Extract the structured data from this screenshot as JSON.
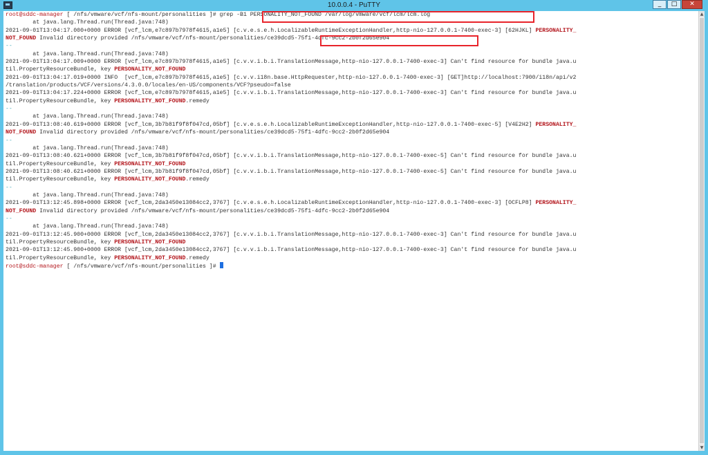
{
  "window": {
    "title": "10.0.0.4 - PuTTY",
    "controls": {
      "minimize": "_",
      "maximize": "□",
      "close": "✕"
    },
    "colors": {
      "titlebar": "#5fc4e8",
      "accent_red": "#b3161c",
      "highlight_box": "#e8232a",
      "cursor": "#1e6fe0"
    }
  },
  "terminal": {
    "lines": [
      [
        {
          "t": "root@sddc-manager",
          "c": "prompt"
        },
        {
          "t": " [ /nfs/vmware/vcf/nfs-mount/personalities ]# ",
          "c": "path"
        },
        {
          "t": "grep -B1 PERSONALITY_NOT_FOUND /var/log/vmware/vcf/lcm/lcm.log",
          "c": "path"
        }
      ],
      [
        {
          "t": "        at java.lang.Thread.run(Thread.java:748)",
          "c": "path"
        }
      ],
      [
        {
          "t": "2021-09-01T13:04:17.000+0000 ERROR [vcf_lcm,e7c897b7978f4615,a1e5] [c.v.e.s.e.h.LocalizableRuntimeExceptionHandler,http-nio-127.0.0.1-7400-exec-3] [62HJKL] ",
          "c": "path"
        },
        {
          "t": "PERSONALITY_",
          "c": "red"
        }
      ],
      [
        {
          "t": "NOT_FOUND",
          "c": "red"
        },
        {
          "t": " Invalid directory provided /nfs/vmware/vcf/nfs-mount/personalities/",
          "c": "path"
        },
        {
          "t": "ce39dcd5-75f1-4dfc-9cc2-2b0f2d65e904",
          "c": "path"
        }
      ],
      [
        {
          "t": "--",
          "c": "cyan"
        }
      ],
      [
        {
          "t": "        at java.lang.Thread.run(Thread.java:748)",
          "c": "path"
        }
      ],
      [
        {
          "t": "2021-09-01T13:04:17.009+0000 ERROR [vcf_lcm,e7c897b7978f4615,a1e5] [c.v.v.i.b.i.TranslationMessage,http-nio-127.0.0.1-7400-exec-3] Can't find resource for bundle java.u",
          "c": "path"
        }
      ],
      [
        {
          "t": "til.PropertyResourceBundle, key ",
          "c": "path"
        },
        {
          "t": "PERSONALITY_NOT_FOUND",
          "c": "red"
        }
      ],
      [
        {
          "t": "2021-09-01T13:04:17.019+0000 INFO  [vcf_lcm,e7c897b7978f4615,a1e5] [c.v.v.i18n.base.HttpRequester,http-nio-127.0.0.1-7400-exec-3] [GET]http://localhost:7900/i18n/api/v2",
          "c": "path"
        }
      ],
      [
        {
          "t": "/translation/products/VCF/versions/4.3.0.0/locales/en-US/components/VCF?pseudo=false",
          "c": "path"
        }
      ],
      [
        {
          "t": "2021-09-01T13:04:17.224+0000 ERROR [vcf_lcm,e7c897b7978f4615,a1e5] [c.v.v.i.b.i.TranslationMessage,http-nio-127.0.0.1-7400-exec-3] Can't find resource for bundle java.u",
          "c": "path"
        }
      ],
      [
        {
          "t": "til.PropertyResourceBundle, key ",
          "c": "path"
        },
        {
          "t": "PERSONALITY_NOT_FOUND",
          "c": "red"
        },
        {
          "t": ".remedy",
          "c": "path"
        }
      ],
      [
        {
          "t": "--",
          "c": "cyan"
        }
      ],
      [
        {
          "t": "        at java.lang.Thread.run(Thread.java:748)",
          "c": "path"
        }
      ],
      [
        {
          "t": "2021-09-01T13:08:40.619+0000 ERROR [vcf_lcm,3b7b81f9f8f047cd,05bf] [c.v.e.s.e.h.LocalizableRuntimeExceptionHandler,http-nio-127.0.0.1-7400-exec-5] [V4E2H2] ",
          "c": "path"
        },
        {
          "t": "PERSONALITY_",
          "c": "red"
        }
      ],
      [
        {
          "t": "NOT_FOUND",
          "c": "red"
        },
        {
          "t": " Invalid directory provided /nfs/vmware/vcf/nfs-mount/personalities/ce39dcd5-75f1-4dfc-9cc2-2b0f2d65e904",
          "c": "path"
        }
      ],
      [
        {
          "t": "--",
          "c": "cyan"
        }
      ],
      [
        {
          "t": "        at java.lang.Thread.run(Thread.java:748)",
          "c": "path"
        }
      ],
      [
        {
          "t": "2021-09-01T13:08:40.621+0000 ERROR [vcf_lcm,3b7b81f9f8f047cd,05bf] [c.v.v.i.b.i.TranslationMessage,http-nio-127.0.0.1-7400-exec-5] Can't find resource for bundle java.u",
          "c": "path"
        }
      ],
      [
        {
          "t": "til.PropertyResourceBundle, key ",
          "c": "path"
        },
        {
          "t": "PERSONALITY_NOT_FOUND",
          "c": "red"
        }
      ],
      [
        {
          "t": "2021-09-01T13:08:40.621+0000 ERROR [vcf_lcm,3b7b81f9f8f047cd,05bf] [c.v.v.i.b.i.TranslationMessage,http-nio-127.0.0.1-7400-exec-5] Can't find resource for bundle java.u",
          "c": "path"
        }
      ],
      [
        {
          "t": "til.PropertyResourceBundle, key ",
          "c": "path"
        },
        {
          "t": "PERSONALITY_NOT_FOUND",
          "c": "red"
        },
        {
          "t": ".remedy",
          "c": "path"
        }
      ],
      [
        {
          "t": "--",
          "c": "cyan"
        }
      ],
      [
        {
          "t": "        at java.lang.Thread.run(Thread.java:748)",
          "c": "path"
        }
      ],
      [
        {
          "t": "2021-09-01T13:12:45.898+0000 ERROR [vcf_lcm,2da3450e13084cc2,3767] [c.v.e.s.e.h.LocalizableRuntimeExceptionHandler,http-nio-127.0.0.1-7400-exec-3] [OCFLP8] ",
          "c": "path"
        },
        {
          "t": "PERSONALITY_",
          "c": "red"
        }
      ],
      [
        {
          "t": "NOT_FOUND",
          "c": "red"
        },
        {
          "t": " Invalid directory provided /nfs/vmware/vcf/nfs-mount/personalities/ce39dcd5-75f1-4dfc-9cc2-2b0f2d65e904",
          "c": "path"
        }
      ],
      [
        {
          "t": "--",
          "c": "cyan"
        }
      ],
      [
        {
          "t": "        at java.lang.Thread.run(Thread.java:748)",
          "c": "path"
        }
      ],
      [
        {
          "t": "2021-09-01T13:12:45.900+0000 ERROR [vcf_lcm,2da3450e13084cc2,3767] [c.v.v.i.b.i.TranslationMessage,http-nio-127.0.0.1-7400-exec-3] Can't find resource for bundle java.u",
          "c": "path"
        }
      ],
      [
        {
          "t": "til.PropertyResourceBundle, key ",
          "c": "path"
        },
        {
          "t": "PERSONALITY_NOT_FOUND",
          "c": "red"
        }
      ],
      [
        {
          "t": "2021-09-01T13:12:45.900+0000 ERROR [vcf_lcm,2da3450e13084cc2,3767] [c.v.v.i.b.i.TranslationMessage,http-nio-127.0.0.1-7400-exec-3] Can't find resource for bundle java.u",
          "c": "path"
        }
      ],
      [
        {
          "t": "til.PropertyResourceBundle, key ",
          "c": "path"
        },
        {
          "t": "PERSONALITY_NOT_FOUND",
          "c": "red"
        },
        {
          "t": ".remedy",
          "c": "path"
        }
      ],
      [
        {
          "t": "root@sddc-manager",
          "c": "prompt"
        },
        {
          "t": " [ /nfs/vmware/vcf/nfs-mount/personalities ]# ",
          "c": "path"
        },
        {
          "t": "",
          "c": "cursor"
        }
      ]
    ]
  }
}
